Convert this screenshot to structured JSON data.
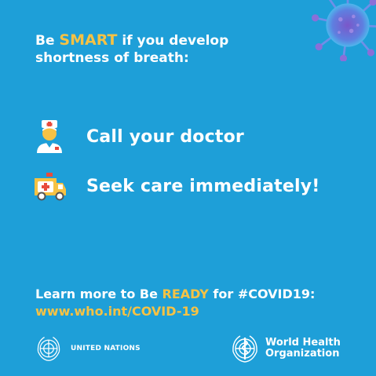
{
  "headline": {
    "prefix": "Be ",
    "smart": "SMART",
    "rest_line1": " if you develop",
    "line2": "shortness of breath:"
  },
  "actions": [
    {
      "label": "Call your doctor",
      "icon": "doctor-icon"
    },
    {
      "label": "Seek care immediately!",
      "icon": "ambulance-icon"
    }
  ],
  "learn": {
    "prefix": "Learn more to Be ",
    "ready": "READY",
    "suffix": " for #COVID19:",
    "url": "www.who.int/COVID-19"
  },
  "footer": {
    "un_name": "UNITED NATIONS",
    "who_line1": "World Health",
    "who_line2": "Organization"
  },
  "colors": {
    "background": "#1e9fd8",
    "accent": "#f6c244",
    "text": "#ffffff"
  }
}
